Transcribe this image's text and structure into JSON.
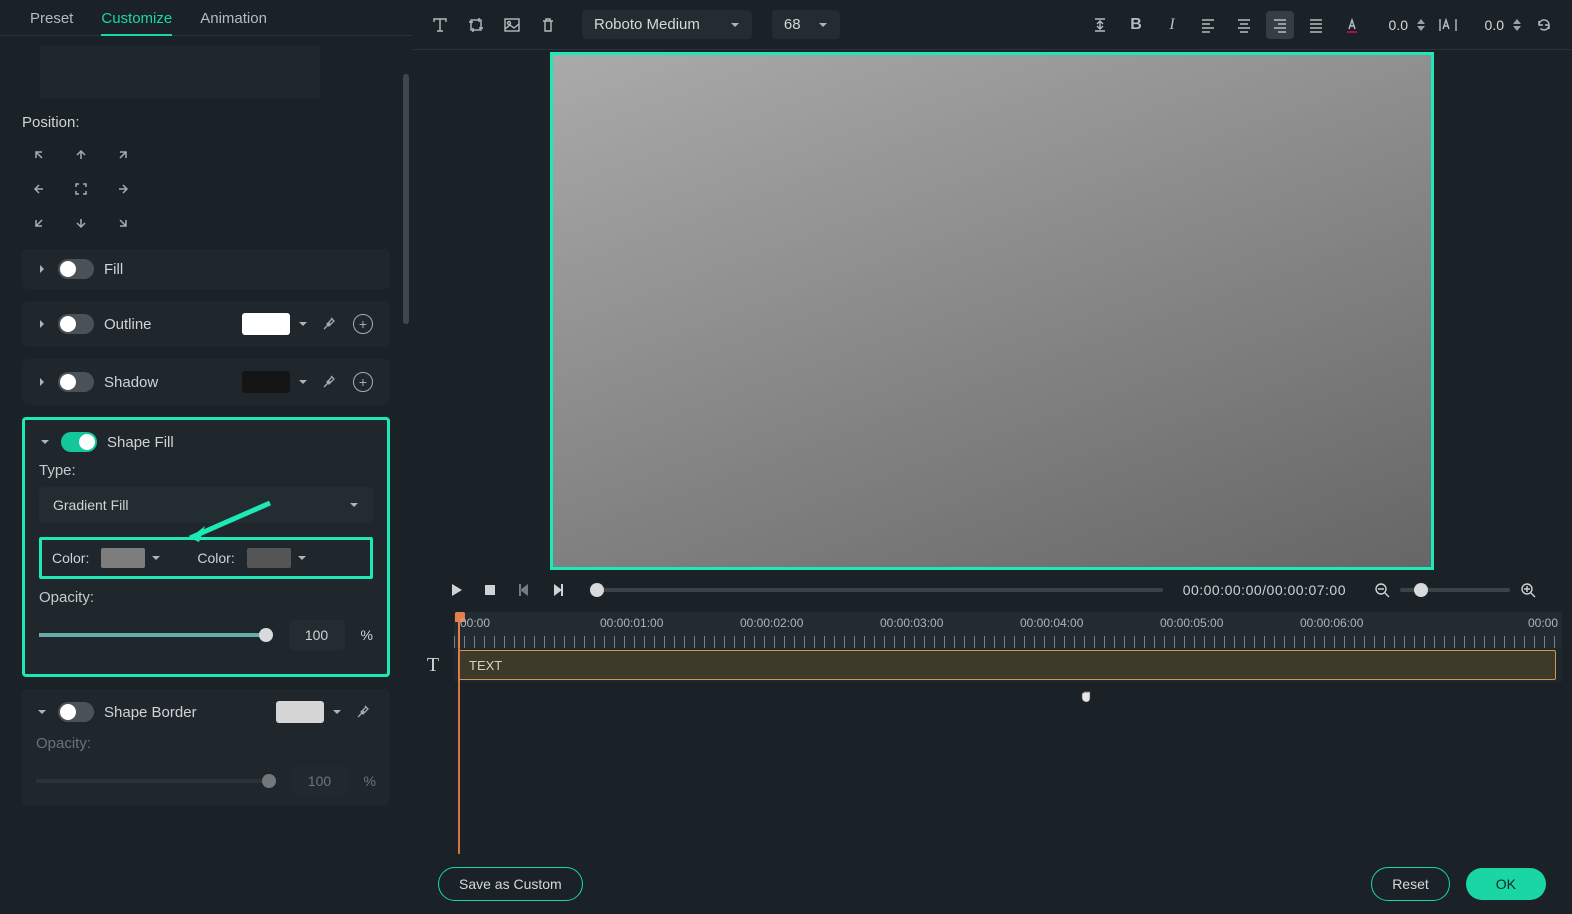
{
  "tabs": {
    "preset": "Preset",
    "customize": "Customize",
    "animation": "Animation"
  },
  "position_label": "Position:",
  "sections": {
    "fill": "Fill",
    "outline": "Outline",
    "shadow": "Shadow",
    "shape_fill": "Shape Fill",
    "shape_border": "Shape Border"
  },
  "type_label": "Type:",
  "type_value": "Gradient Fill",
  "color_label": "Color:",
  "opacity_label": "Opacity:",
  "opacity_value": "100",
  "opacity_unit": "%",
  "border_opacity_value": "100",
  "border_opacity_unit": "%",
  "toolbar": {
    "font": "Roboto Medium",
    "size": "68",
    "line_height": "0.0",
    "letter_spacing": "0.0"
  },
  "timecode": "00:00:00:00/00:00:07:00",
  "ruler_marks": [
    "00:00",
    "00:00:01:00",
    "00:00:02:00",
    "00:00:03:00",
    "00:00:04:00",
    "00:00:05:00",
    "00:00:06:00",
    "00:00"
  ],
  "clip_label": "TEXT",
  "footer": {
    "save": "Save as Custom",
    "reset": "Reset",
    "ok": "OK"
  },
  "colors": {
    "outline_swatch": "#ffffff",
    "shadow_swatch": "#1b1b1b",
    "grad1": "#808080",
    "grad2": "#555555",
    "border_swatch": "#d6d6d6"
  }
}
